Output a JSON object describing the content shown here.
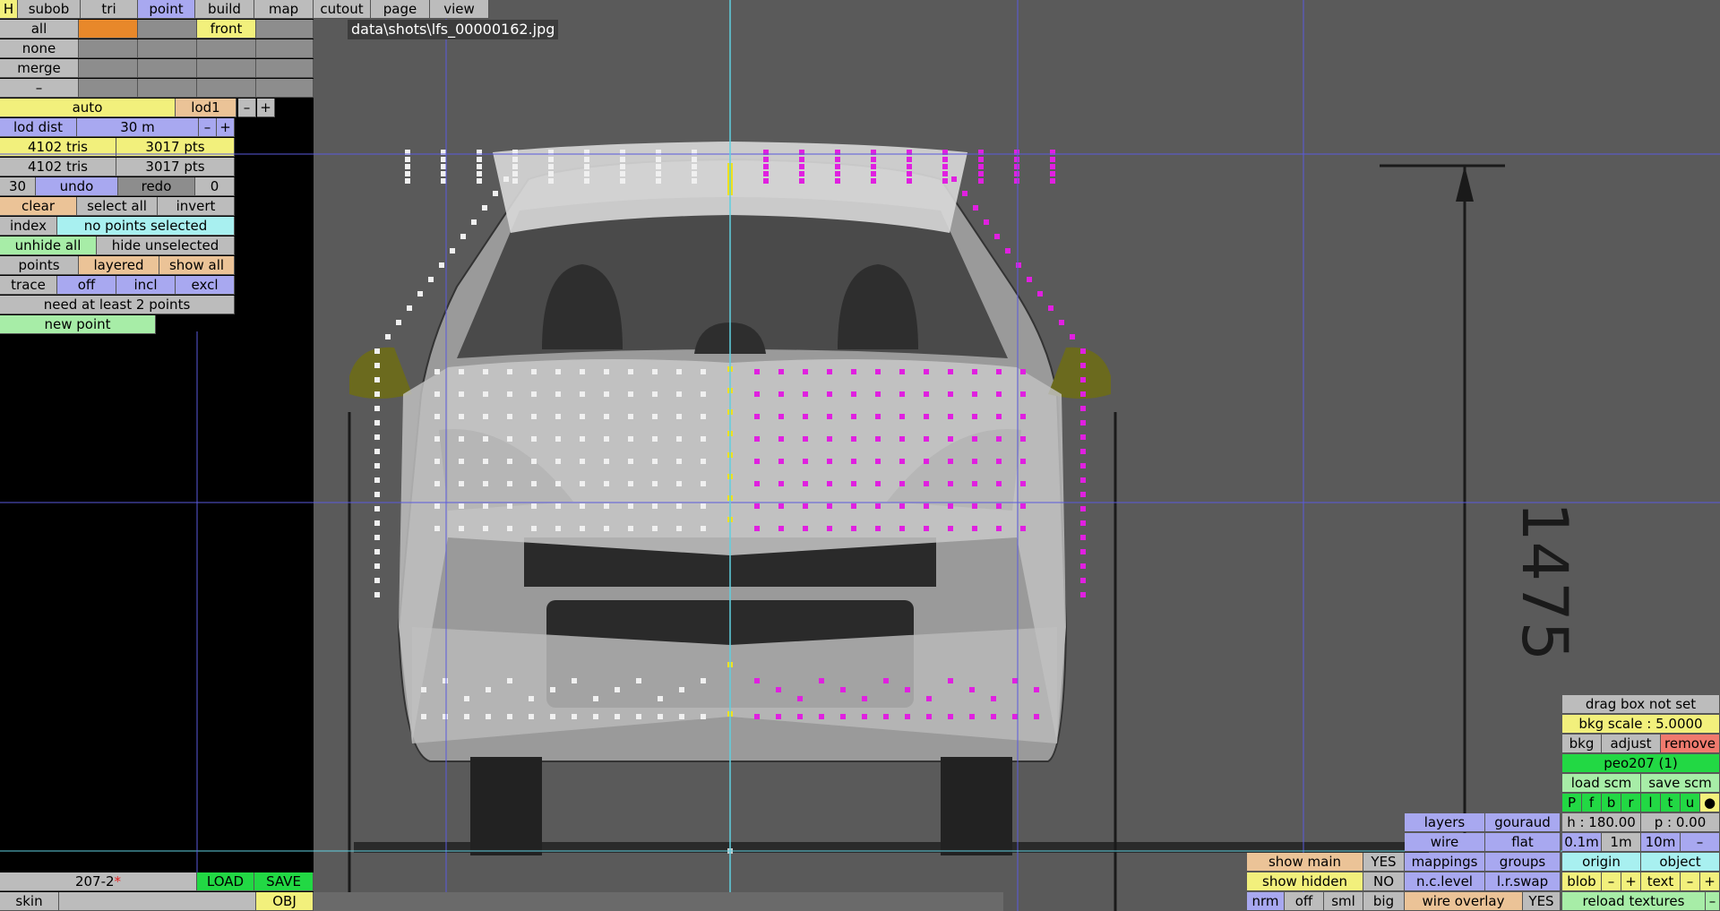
{
  "menu": {
    "h": "H",
    "items": [
      "subob",
      "tri",
      "point",
      "build",
      "map",
      "cutout",
      "page",
      "view"
    ]
  },
  "selrows": {
    "all": "all",
    "front": "front",
    "none": "none",
    "merge": "merge",
    "dash": "–"
  },
  "lod": {
    "auto": "auto",
    "lod1": "lod1",
    "minus": "–",
    "plus": "+",
    "dist_label": "lod dist",
    "dist_value": "30 m"
  },
  "stats": {
    "tris1": "4102 tris",
    "pts1": "3017 pts",
    "tris2": "4102 tris",
    "pts2": "3017 pts"
  },
  "undo": {
    "count": "30",
    "undo": "undo",
    "redo": "redo",
    "redo_count": "0"
  },
  "selection": {
    "clear": "clear",
    "select_all": "select all",
    "invert": "invert",
    "index": "index",
    "status": "no points selected",
    "unhide_all": "unhide all",
    "hide_unselected": "hide unselected",
    "points": "points",
    "layered": "layered",
    "show_all": "show all",
    "trace": "trace",
    "off": "off",
    "incl": "incl",
    "excl": "excl",
    "hint": "need at least 2 points",
    "new_point": "new point"
  },
  "bottom_left": {
    "file": "207-2",
    "modified": "*",
    "load": "LOAD",
    "save": "SAVE",
    "skin": "skin",
    "obj": "OBJ"
  },
  "viewport": {
    "filename": "data\\shots\\lfs_00000162.jpg",
    "dimension_text": "1475"
  },
  "right_panel": {
    "drag_box": "drag box not set",
    "bkg_scale": "bkg scale : 5.0000",
    "bkg": "bkg",
    "adjust": "adjust",
    "remove": "remove",
    "car": "peo207 (1)",
    "load_scm": "load scm",
    "save_scm": "save scm",
    "views": [
      "P",
      "f",
      "b",
      "r",
      "l",
      "t",
      "u",
      "●"
    ],
    "h": "h : 180.00",
    "p": "p : 0.00",
    "grid": [
      "0.1m",
      "1m",
      "10m",
      "–"
    ],
    "origin": "origin",
    "object": "object",
    "blob": "blob",
    "minus": "–",
    "plus": "+",
    "text": "text",
    "reload": "reload textures",
    "dash": "–"
  },
  "bottom_mid": {
    "layers": "layers",
    "gouraud": "gouraud",
    "wire": "wire",
    "flat": "flat",
    "mappings": "mappings",
    "groups": "groups",
    "nclevel": "n.c.level",
    "lrswap": "l.r.swap",
    "wire_overlay": "wire overlay",
    "wire_overlay_val": "YES",
    "show_main": "show main",
    "show_main_val": "YES",
    "show_hidden": "show hidden",
    "show_hidden_val": "NO",
    "nrm": "nrm",
    "off": "off",
    "sml": "sml",
    "big": "big"
  },
  "colors": {
    "selected_points": "#e020e0",
    "center_points": "#f0e020",
    "unselected_points": "#f0f0f0",
    "grid_lines": "#5a5adc",
    "axis_line": "#60d0e0"
  }
}
